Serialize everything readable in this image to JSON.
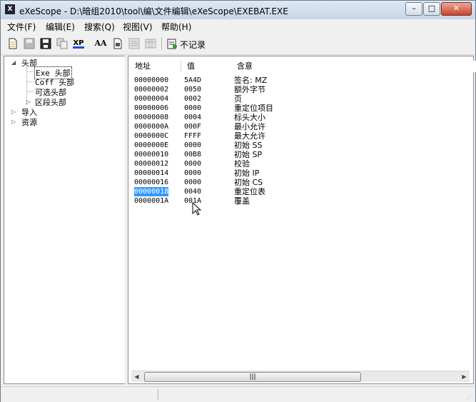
{
  "window": {
    "title": "eXeScope - D:\\暗组2010\\tool\\编\\文件编辑\\eXeScope\\EXEBAT.EXE",
    "icon_letter": "X",
    "controls": {
      "minimize": "–",
      "maximize": "□",
      "close": "✕"
    }
  },
  "menu": {
    "items": [
      "文件(F)",
      "编辑(E)",
      "搜索(Q)",
      "视图(V)",
      "帮助(H)"
    ]
  },
  "toolbar": {
    "icons": [
      "new-file-icon",
      "save-icon",
      "save-as-icon",
      "copy-icon",
      "xp-icon",
      "font-icon",
      "resource-icon",
      "compare-icon",
      "grid-icon",
      "record-icon"
    ],
    "xp_label": "XP",
    "font_label": "AA",
    "no_record_label": "不记录"
  },
  "tree": {
    "root": "头部",
    "children": [
      "Exe 头部",
      "Coff 头部",
      "可选头部",
      "区段头部"
    ],
    "siblings": [
      "导入",
      "资源"
    ]
  },
  "list": {
    "columns": [
      "地址",
      "值",
      "含意"
    ],
    "rows": [
      {
        "addr": "00000000",
        "val": "5A4D",
        "meaning": "签名: MZ"
      },
      {
        "addr": "00000002",
        "val": "0050",
        "meaning": "额外字节"
      },
      {
        "addr": "00000004",
        "val": "0002",
        "meaning": "页"
      },
      {
        "addr": "00000006",
        "val": "0000",
        "meaning": "重定位项目"
      },
      {
        "addr": "00000008",
        "val": "0004",
        "meaning": "标头大小"
      },
      {
        "addr": "0000000A",
        "val": "000F",
        "meaning": "最小允许"
      },
      {
        "addr": "0000000C",
        "val": "FFFF",
        "meaning": "最大允许"
      },
      {
        "addr": "0000000E",
        "val": "0000",
        "meaning": "初始 SS"
      },
      {
        "addr": "00000010",
        "val": "00B8",
        "meaning": "初始 SP"
      },
      {
        "addr": "00000012",
        "val": "0000",
        "meaning": "校验"
      },
      {
        "addr": "00000014",
        "val": "0000",
        "meaning": "初始 IP"
      },
      {
        "addr": "00000016",
        "val": "0000",
        "meaning": "初始 CS"
      },
      {
        "addr": "00000018",
        "val": "0040",
        "meaning": "重定位表"
      },
      {
        "addr": "0000001A",
        "val": "001A",
        "meaning": "覆盖"
      }
    ],
    "selected_address": "00000018"
  },
  "scrollbar": {
    "thumb_label": "|||"
  }
}
